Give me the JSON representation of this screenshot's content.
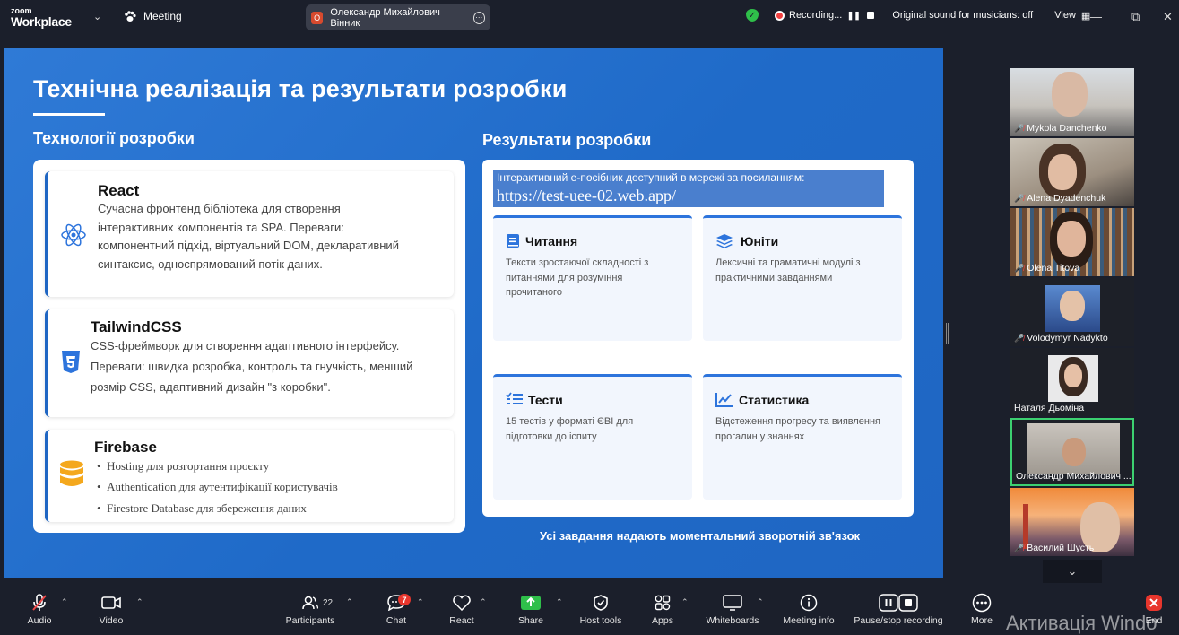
{
  "app": {
    "logo_line1": "zoom",
    "logo_line2": "Workplace",
    "meeting_label": "Meeting",
    "active_speaker": "Олександр Михайлович Вінник",
    "speaker_initial": "O",
    "recording_label": "Recording...",
    "sound_label": "Original sound for musicians: off",
    "view_label": "View"
  },
  "slide": {
    "title": "Технічна реалізація та результати розробки",
    "left_heading": "Технології розробки",
    "right_heading": "Результати розробки",
    "tech": [
      {
        "name": "React",
        "desc_lines": [
          "Сучасна фронтенд бібліотека для створення",
          "інтерактивних компонентів та SPA. Переваги:",
          "компонентний підхід, віртуальний DOM, декларативний",
          "синтаксис, односпрямований потік даних."
        ],
        "icon": "react-icon"
      },
      {
        "name": "TailwindCSS",
        "desc_lines": [
          "CSS-фреймворк для створення адаптивного інтерфейсу.",
          "Переваги: швидка розробка, контроль та гнучкість, менший",
          "розмір CSS, адаптивний дизайн \"з коробки\"."
        ],
        "icon": "css3-icon"
      },
      {
        "name": "Firebase",
        "bullets": [
          "Hosting для розгортання проєкту",
          "Authentication для аутентифікації користувачів",
          "Firestore Database для збереження даних"
        ],
        "icon": "database-icon"
      }
    ],
    "link_text": "Інтерактивний е-посібник доступний в мережі за посиланням:",
    "link_url": "https://test-uee-02.web.app/",
    "results": [
      {
        "title": "Читання",
        "desc": "Тексти зростаючої складності з питаннями для розуміння прочитаного",
        "icon": "book-icon"
      },
      {
        "title": "Юніти",
        "desc": "Лексичні та граматичні модулі з практичними завданнями",
        "icon": "layers-icon"
      },
      {
        "title": "Тести",
        "desc": "15 тестів у форматі ЄВІ для підготовки до іспиту",
        "icon": "checklist-icon"
      },
      {
        "title": "Статистика",
        "desc": "Відстеження прогресу та виявлення прогалин у знаннях",
        "icon": "line-chart-icon"
      }
    ],
    "footer_note": "Усі завдання надають моментальний зворотній зв'язок"
  },
  "participants": [
    {
      "name": "Mykola Danchenko",
      "muted": true
    },
    {
      "name": "Alena Dyadenchuk",
      "muted": true
    },
    {
      "name": "Olena Titova",
      "muted": true
    },
    {
      "name": "Volodymyr Nadykto",
      "muted": true
    },
    {
      "name": "Наталя Дьоміна",
      "muted": false
    },
    {
      "name": "Олександр Михайлович ...",
      "muted": false,
      "active": true
    },
    {
      "name": "Василий Шусть",
      "muted": true
    }
  ],
  "toolbar": {
    "audio": "Audio",
    "video": "Video",
    "participants": "Participants",
    "participants_count": "22",
    "chat": "Chat",
    "chat_badge": "7",
    "react": "React",
    "share": "Share",
    "host_tools": "Host tools",
    "apps": "Apps",
    "whiteboards": "Whiteboards",
    "meeting_info": "Meeting info",
    "pause_recording": "Pause/stop recording",
    "more": "More",
    "end": "End"
  },
  "watermark": "Активація Windo",
  "colors": {
    "slide_bg": "#1f66c3",
    "accent_blue": "#2d74dc",
    "share_green": "#2fbf4a",
    "active_speaker_border": "#3cd070",
    "mute_red": "#f04848"
  }
}
